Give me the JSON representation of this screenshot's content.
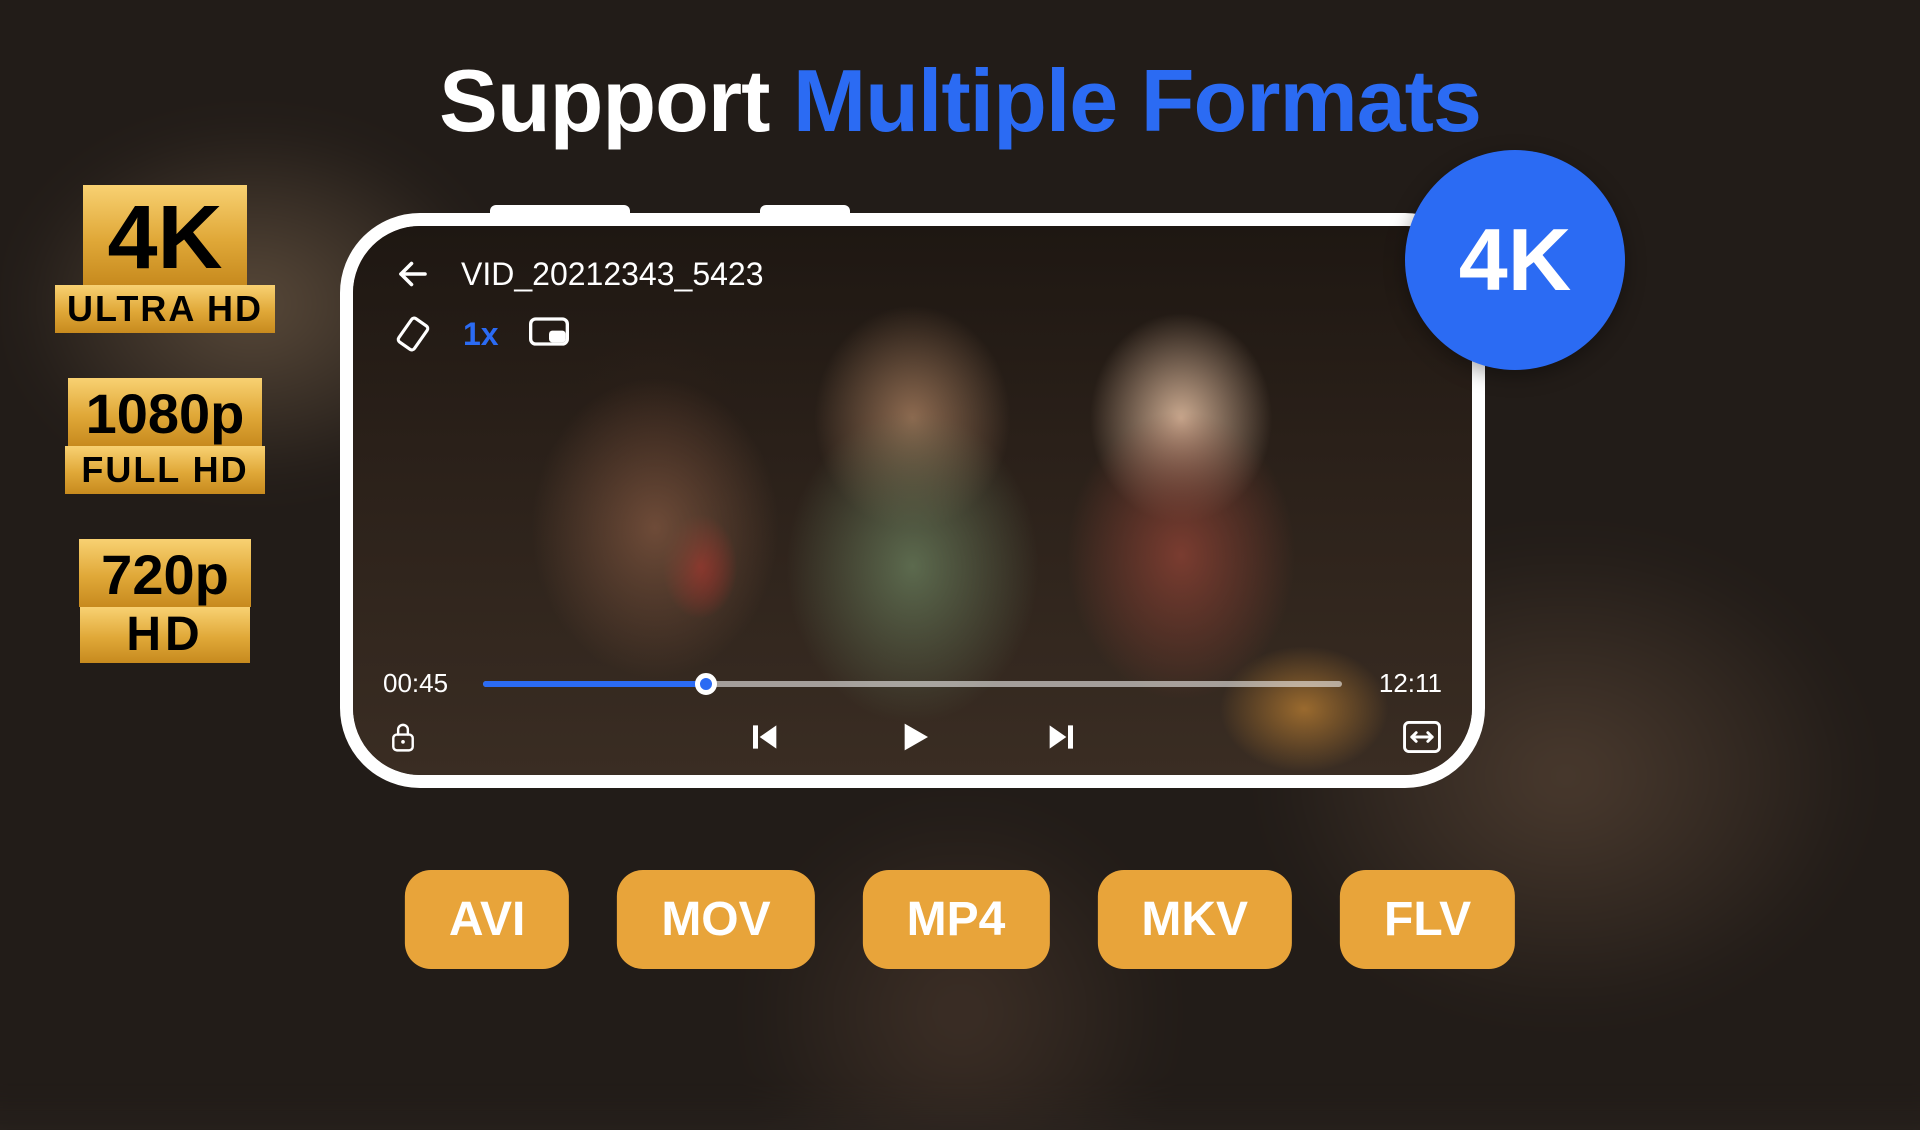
{
  "title": {
    "part1": "Support ",
    "part2": "Multiple Formats"
  },
  "resolution_badges": [
    {
      "line1": "4K",
      "line2": "ULTRA HD",
      "cls": "badge-4k"
    },
    {
      "line1": "1080p",
      "line2": "FULL HD",
      "cls": "badge-1080"
    },
    {
      "line1": "720p",
      "line2": "HD",
      "cls": "badge-720"
    }
  ],
  "bubble": {
    "label": "4K"
  },
  "player": {
    "filename": "VID_20212343_5423",
    "speed_label": "1x",
    "elapsed": "00:45",
    "duration": "12:11",
    "progress_percent": 26
  },
  "formats": [
    "AVI",
    "MOV",
    "MP4",
    "MKV",
    "FLV"
  ],
  "colors": {
    "accent_blue": "#2B6BF3",
    "gold": "#E8A43A"
  }
}
